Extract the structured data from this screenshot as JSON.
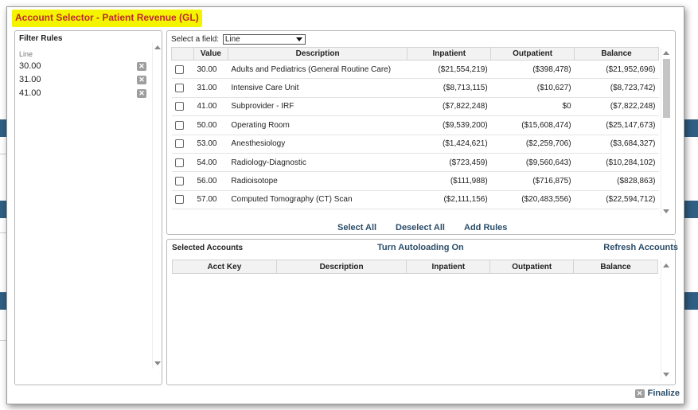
{
  "dialog": {
    "title": "Account Selector - Patient Revenue (GL)"
  },
  "filter": {
    "title": "Filter Rules",
    "group_label": "Line",
    "rules": [
      "30.00",
      "31.00",
      "41.00"
    ],
    "remove_icon": "x-icon"
  },
  "field": {
    "label": "Select a field:",
    "selected": "Line"
  },
  "accounts": {
    "headers": [
      "",
      "Value",
      "Description",
      "Inpatient",
      "Outpatient",
      "Balance"
    ],
    "rows": [
      [
        "30.00",
        "Adults and Pediatrics (General Routine Care)",
        "($21,554,219)",
        "($398,478)",
        "($21,952,696)"
      ],
      [
        "31.00",
        "Intensive Care Unit",
        "($8,713,115)",
        "($10,627)",
        "($8,723,742)"
      ],
      [
        "41.00",
        "Subprovider - IRF",
        "($7,822,248)",
        "$0",
        "($7,822,248)"
      ],
      [
        "50.00",
        "Operating Room",
        "($9,539,200)",
        "($15,608,474)",
        "($25,147,673)"
      ],
      [
        "53.00",
        "Anesthesiology",
        "($1,424,621)",
        "($2,259,706)",
        "($3,684,327)"
      ],
      [
        "54.00",
        "Radiology-Diagnostic",
        "($723,459)",
        "($9,560,643)",
        "($10,284,102)"
      ],
      [
        "56.00",
        "Radioisotope",
        "($111,988)",
        "($716,875)",
        "($828,863)"
      ],
      [
        "57.00",
        "Computed Tomography (CT) Scan",
        "($2,111,156)",
        "($20,483,556)",
        "($22,594,712)"
      ]
    ]
  },
  "actions": {
    "select_all": "Select All",
    "deselect_all": "Deselect All",
    "add_rules": "Add Rules"
  },
  "selected": {
    "title": "Selected Accounts",
    "autoload": "Turn Autoloading On",
    "refresh": "Refresh Accounts",
    "headers": [
      "Acct Key",
      "Description",
      "Inpatient",
      "Outpatient",
      "Balance"
    ]
  },
  "finalize": {
    "label": "Finalize"
  }
}
